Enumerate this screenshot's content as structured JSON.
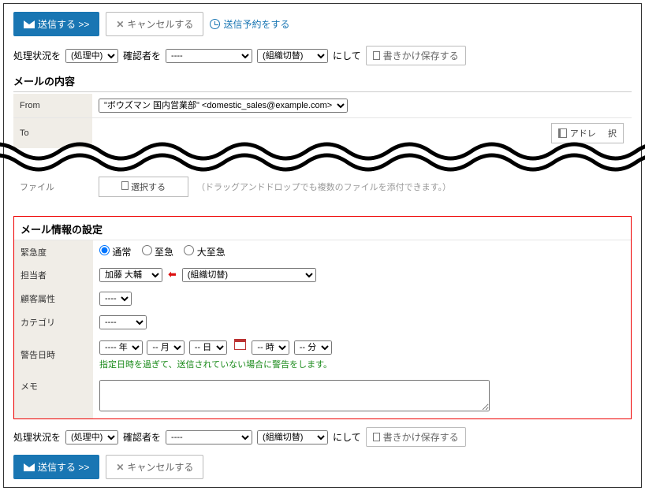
{
  "buttons": {
    "send": "送信する >>",
    "cancel": "キャンセルする",
    "schedule": "送信予約をする",
    "saveDraft": "書きかけ保存する",
    "addressBook": "アドレス帳",
    "fileSelect": "選択する"
  },
  "labels": {
    "processStatusTo": "処理状況を",
    "approverTo": "確認者を",
    "toLabel": "にして",
    "mailContent": "メールの内容",
    "from": "From",
    "to": "To",
    "file": "ファイル",
    "mailInfoSettings": "メール情報の設定",
    "urgency": "緊急度",
    "assignee": "担当者",
    "customerAttr": "顧客属性",
    "category": "カテゴリ",
    "warnDate": "警告日時",
    "memo": "メモ"
  },
  "hints": {
    "fileHint": "（ドラッグアンドドロップでも複数のファイルを添付できます。）",
    "warnDateHelp": "指定日時を過ぎて、送信されていない場合に警告をします。"
  },
  "values": {
    "processStatus": "(処理中)",
    "approver": "----",
    "orgSwitch": "(組織切替)",
    "from": "\"ボウズマン 国内営業部\" <domestic_sales@example.com>",
    "assignee": "加藤 大輔",
    "customerAttr": "----",
    "category": "----",
    "year": "---- 年",
    "month": "-- 月",
    "day": "-- 日",
    "hour": "-- 時",
    "minute": "-- 分"
  },
  "urgency": {
    "normal": "通常",
    "urgent": "至急",
    "veryUrgent": "大至急"
  }
}
